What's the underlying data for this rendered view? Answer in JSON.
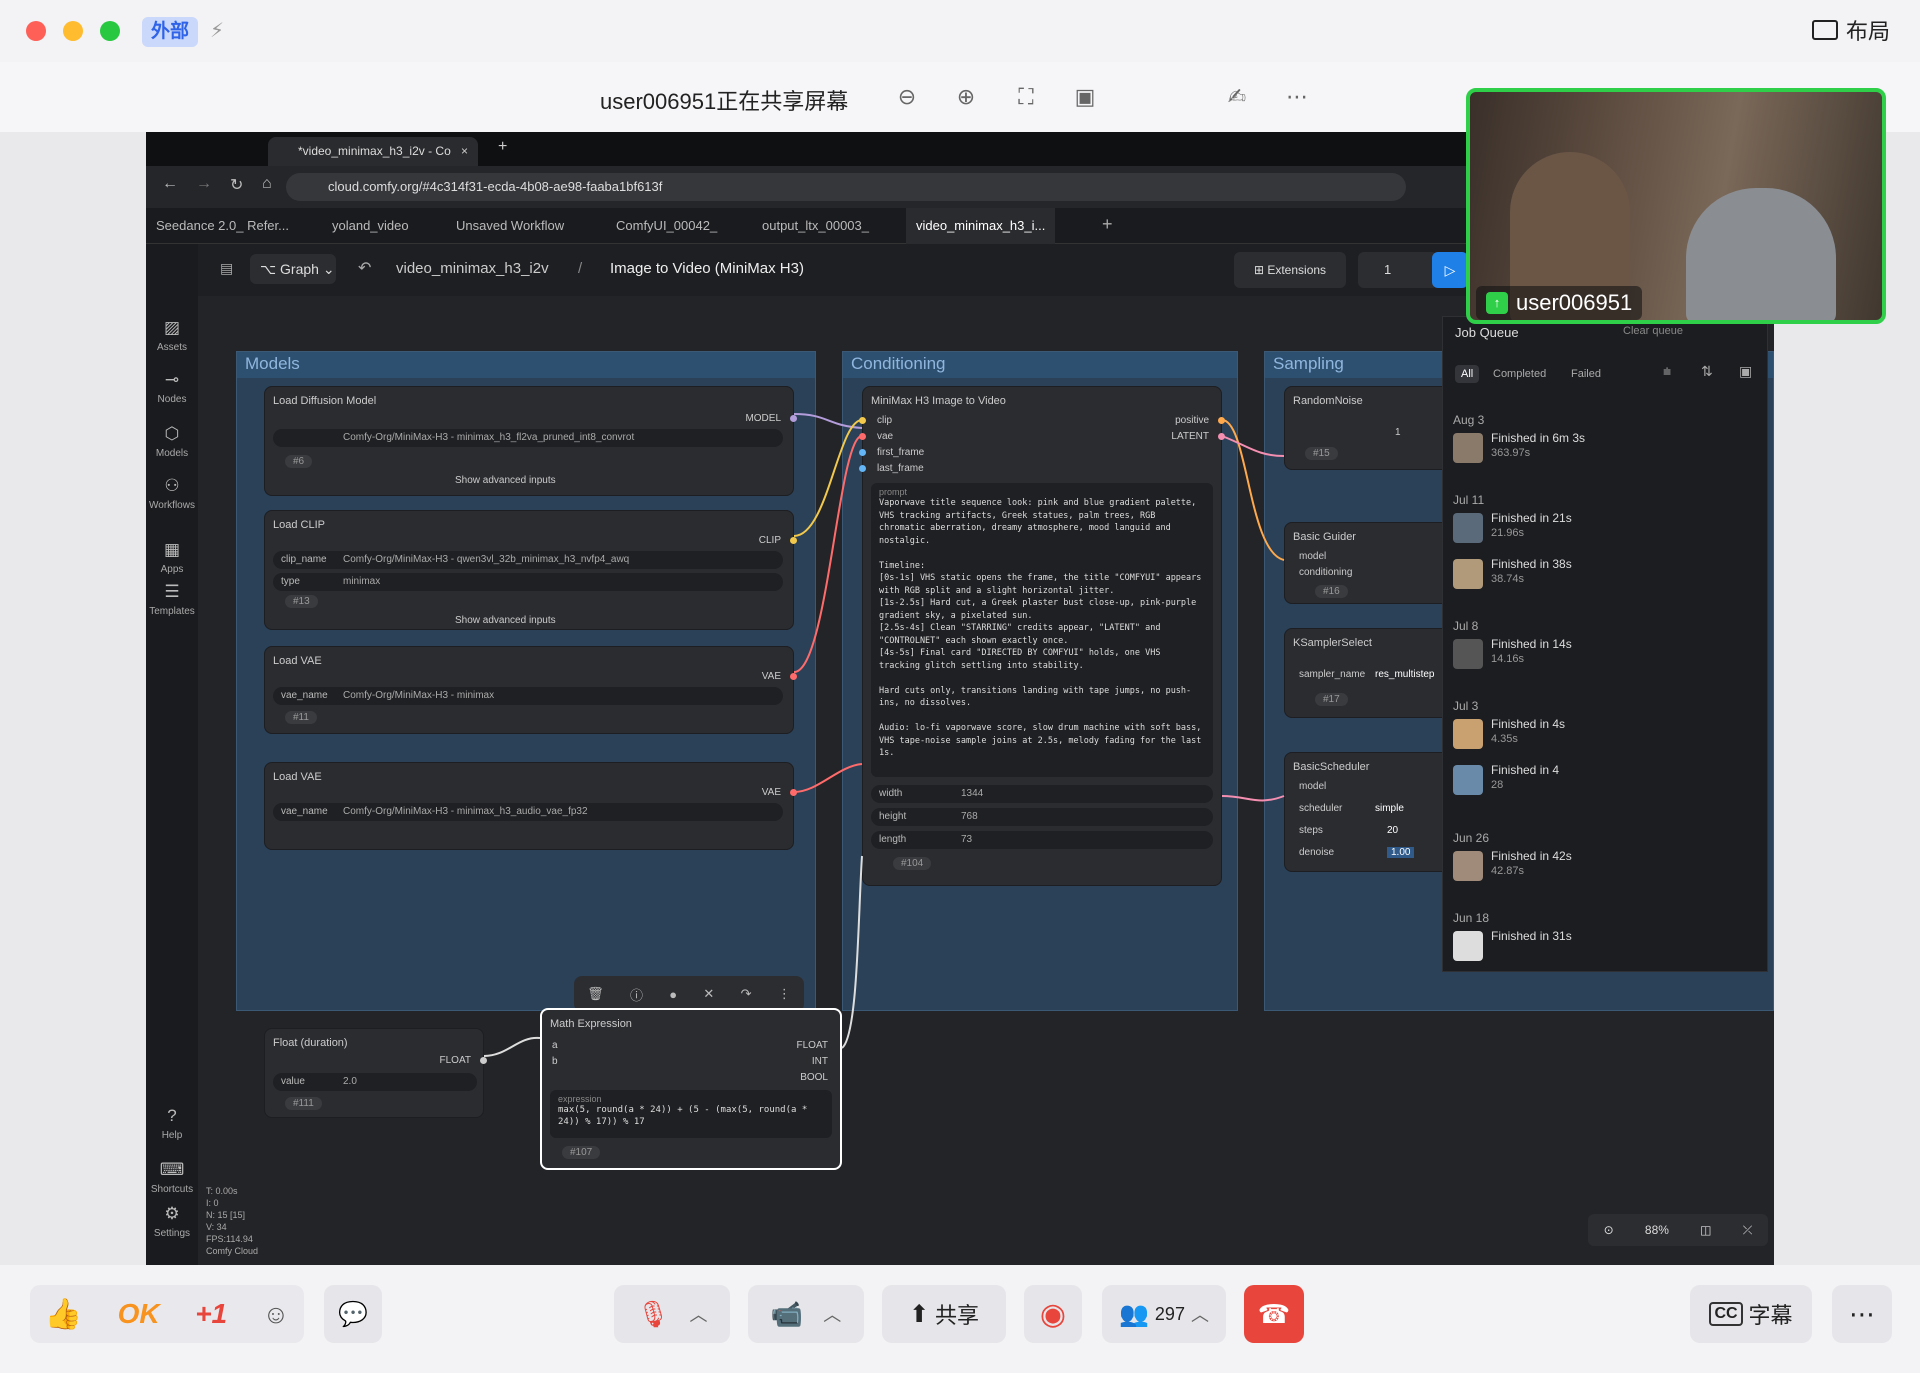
{
  "meeting": {
    "external_tag": "外部",
    "layout_label": "布局",
    "share_title": "user006951正在共享屏幕",
    "video_name": "user006951"
  },
  "browser": {
    "tab_title": "*video_minimax_h3_i2v - Co",
    "url": "cloud.comfy.org/#4c314f31-ecda-4b08-ae98-faaba1bf613f"
  },
  "workflow_tabs": [
    {
      "label": "Seedance 2.0_ Refer..."
    },
    {
      "label": "yoland_video"
    },
    {
      "label": "Unsaved Workflow"
    },
    {
      "label": "ComfyUI_00042_"
    },
    {
      "label": "output_ltx_00003_"
    },
    {
      "label": "video_minimax_h3_i..."
    }
  ],
  "appbar": {
    "graph_label": "Graph",
    "workflow_name": "video_minimax_h3_i2v",
    "breadcrumb_sep": "/",
    "subgraph_name": "Image to Video (MiniMax H3)",
    "extensions_label": "Extensions",
    "run_count": "1"
  },
  "sidebar": [
    {
      "label": "Assets"
    },
    {
      "label": "Nodes"
    },
    {
      "label": "Models"
    },
    {
      "label": "Workflows"
    },
    {
      "label": "Apps"
    },
    {
      "label": "Templates"
    },
    {
      "label": "Help"
    },
    {
      "label": "Shortcuts"
    },
    {
      "label": "Settings"
    }
  ],
  "groups": {
    "models": "Models",
    "conditioning": "Conditioning",
    "sampling": "Sampling"
  },
  "nodes": {
    "load_diffusion": {
      "title": "Load Diffusion Model",
      "output": "MODEL",
      "value": "Comfy-Org/MiniMax-H3 - minimax_h3_fl2va_pruned_int8_convrot",
      "id": "#6",
      "advanced": "Show advanced inputs"
    },
    "load_clip": {
      "title": "Load CLIP",
      "output": "CLIP",
      "clip_label": "clip_name",
      "clip_value": "Comfy-Org/MiniMax-H3 - qwen3vl_32b_minimax_h3_nvfp4_awq",
      "type_label": "type",
      "type_value": "minimax",
      "id": "#13",
      "advanced": "Show advanced inputs"
    },
    "load_vae1": {
      "title": "Load VAE",
      "output": "VAE",
      "label": "vae_name",
      "value": "Comfy-Org/MiniMax-H3 - minimax",
      "id": "#11"
    },
    "load_vae2": {
      "title": "Load VAE",
      "output": "VAE",
      "label": "vae_name",
      "value": "Comfy-Org/MiniMax-H3 - minimax_h3_audio_vae_fp32"
    },
    "float_duration": {
      "title": "Float (duration)",
      "output": "FLOAT",
      "label": "value",
      "value": "2.0",
      "id": "#111"
    },
    "math": {
      "title": "Math Expression",
      "in_a": "a",
      "in_b": "b",
      "out_float": "FLOAT",
      "out_int": "INT",
      "out_bool": "BOOL",
      "expr_label": "expression",
      "expr": "max(5, round(a * 24)) + (5 - (max(5, round(a * 24)) % 17)) % 17",
      "id": "#107"
    },
    "minimax_i2v": {
      "title": "MiniMax H3 Image to Video",
      "inputs": [
        "clip",
        "vae",
        "first_frame",
        "last_frame"
      ],
      "outputs": [
        "positive",
        "LATENT"
      ],
      "prompt_label": "prompt",
      "prompt": "Vaporwave title sequence look: pink and blue gradient palette, VHS tracking artifacts, Greek statues, palm trees, RGB chromatic aberration, dreamy atmosphere, mood languid and nostalgic.\n\nTimeline:\n[0s-1s] VHS static opens the frame, the title \"COMFYUI\" appears with RGB split and a slight horizontal jitter.\n[1s-2.5s] Hard cut, a Greek plaster bust close-up, pink-purple gradient sky, a pixelated sun.\n[2.5s-4s] Clean \"STARRING\" credits appear, \"LATENT\" and \"CONTROLNET\" each shown exactly once.\n[4s-5s] Final card \"DIRECTED BY COMFYUI\" holds, one VHS tracking glitch settling into stability.\n\nHard cuts only, transitions landing with tape jumps, no push-ins, no dissolves.\n\nAudio: lo-fi vaporwave score, slow drum machine with soft bass, VHS tape-noise sample joins at 2.5s, melody fading for the last 1s.",
      "width_label": "width",
      "width": "1344",
      "height_label": "height",
      "height": "768",
      "length_label": "length",
      "length": "73",
      "id": "#104"
    },
    "random_noise": {
      "title": "RandomNoise",
      "value": "1",
      "id": "#15"
    },
    "basic_guider": {
      "title": "Basic Guider",
      "in1": "model",
      "in2": "conditioning",
      "id": "#16"
    },
    "ksampler_select": {
      "title": "KSamplerSelect",
      "label": "sampler_name",
      "value": "res_multistep",
      "id": "#17"
    },
    "basic_scheduler": {
      "title": "BasicScheduler",
      "in1": "model",
      "sched_label": "scheduler",
      "sched": "simple",
      "steps_label": "steps",
      "steps": "20",
      "denoise_label": "denoise",
      "denoise": "1.00"
    }
  },
  "job_queue": {
    "title": "Job Queue",
    "clear": "Clear queue",
    "filters": [
      "All",
      "Completed",
      "Failed"
    ],
    "groups": [
      {
        "date": "Aug 3",
        "items": [
          {
            "title": "Finished in 6m 3s",
            "sub": "363.97s"
          }
        ]
      },
      {
        "date": "Jul 11",
        "items": [
          {
            "title": "Finished in 21s",
            "sub": "21.96s"
          },
          {
            "title": "Finished in 38s",
            "sub": "38.74s"
          }
        ]
      },
      {
        "date": "Jul 8",
        "items": [
          {
            "title": "Finished in 14s",
            "sub": "14.16s"
          }
        ]
      },
      {
        "date": "Jul 3",
        "items": [
          {
            "title": "Finished in 4s",
            "sub": "4.35s"
          },
          {
            "title": "Finished in 4",
            "sub": "28"
          }
        ]
      },
      {
        "date": "Jun 26",
        "items": [
          {
            "title": "Finished in 42s",
            "sub": "42.87s"
          }
        ]
      },
      {
        "date": "Jun 18",
        "items": [
          {
            "title": "Finished in 31s",
            "sub": ""
          }
        ]
      }
    ]
  },
  "stats": [
    "T: 0.00s",
    "I: 0",
    "N: 15 [15]",
    "V: 34",
    "FPS:114.94",
    "Comfy Cloud"
  ],
  "zoom": "88%",
  "bottom_bar": {
    "ok": "OK",
    "plus_one": "+1",
    "share": "共享",
    "participants": "297",
    "captions": "字幕"
  }
}
